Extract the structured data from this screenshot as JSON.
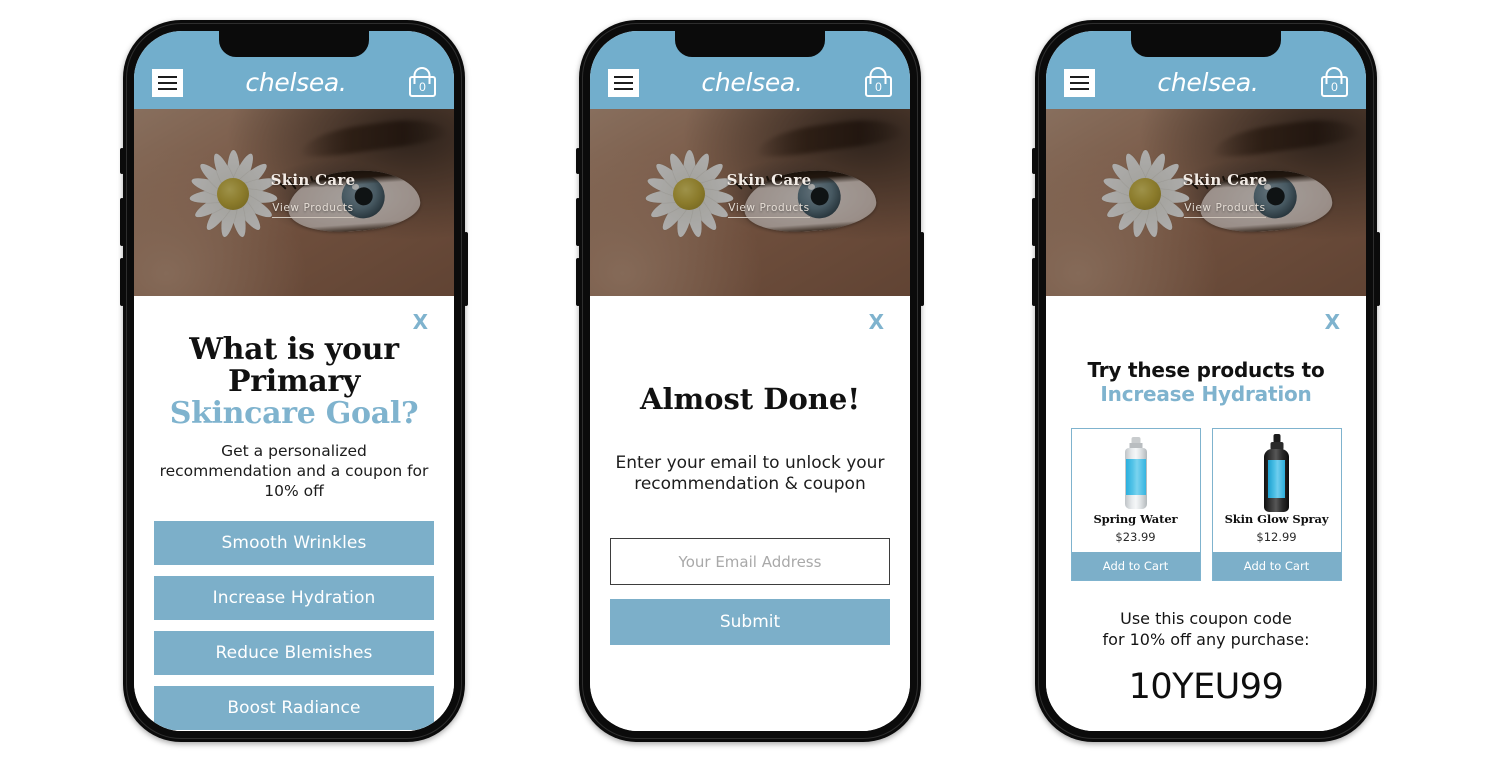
{
  "app": {
    "brand": "chelsea.",
    "menu_icon": "hamburger-icon",
    "cart_icon": "shopping-bag-icon",
    "cart_count": "0"
  },
  "hero": {
    "title": "Skin Care",
    "link": "View Products"
  },
  "colors": {
    "header_blue": "#72aecc",
    "button_blue": "#7cafc9",
    "accent_blue": "#7fb3ce",
    "white": "#ffffff",
    "text_dark": "#111111"
  },
  "phones": [
    {
      "name": "quiz-step",
      "close_label": "X",
      "title_line1": "What is your",
      "title_line2": "Primary",
      "title_line3": "Skincare Goal?",
      "subtitle": "Get a personalized recommendation and a coupon for 10% off",
      "options": [
        "Smooth Wrinkles",
        "Increase Hydration",
        "Reduce Blemishes",
        "Boost Radiance"
      ]
    },
    {
      "name": "email-capture-step",
      "close_label": "X",
      "title": "Almost  Done!",
      "subtitle": "Enter your email to unlock your recommendation & coupon",
      "email_value": "",
      "email_placeholder": "Your Email Address",
      "submit_label": "Submit"
    },
    {
      "name": "results-step",
      "close_label": "X",
      "title_line1": "Try these products to",
      "title_line2": "Increase Hydration",
      "products": [
        {
          "name": "Spring Water",
          "price": "$23.99",
          "cta": "Add to Cart",
          "image": "spray-can-light"
        },
        {
          "name": "Skin Glow Spray",
          "price": "$12.99",
          "cta": "Add to Cart",
          "image": "spray-bottle-dark"
        }
      ],
      "coupon_note_line1": "Use this coupon code",
      "coupon_note_line2": "for 10% off any purchase:",
      "coupon_code": "10YEU99"
    }
  ]
}
